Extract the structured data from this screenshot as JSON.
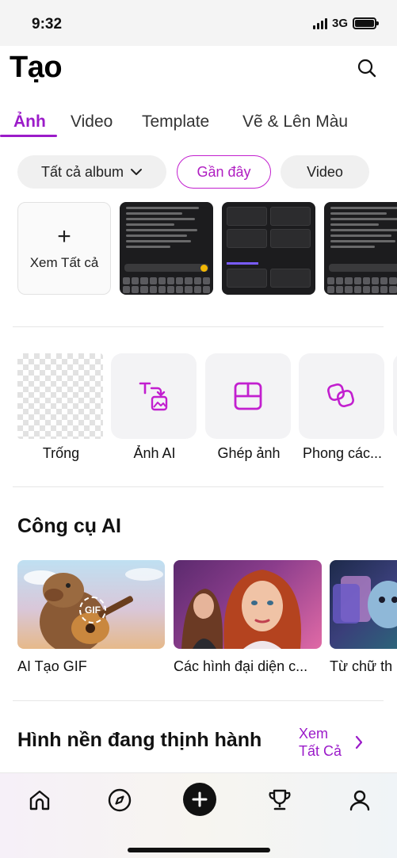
{
  "status_bar": {
    "time": "9:32",
    "network": "3G"
  },
  "header": {
    "title": "Tạo"
  },
  "tabs": [
    {
      "label": "Ảnh",
      "active": true
    },
    {
      "label": "Video",
      "active": false
    },
    {
      "label": "Template",
      "active": false
    },
    {
      "label": "Vẽ & Lên Màu",
      "active": false
    }
  ],
  "filters": {
    "album_label": "Tất cả album",
    "recent_label": "Gần đây",
    "video_label": "Video"
  },
  "recent": {
    "see_all_label": "Xem Tất cả"
  },
  "tools": [
    {
      "label": "Trống",
      "icon": "transparent-canvas-icon"
    },
    {
      "label": "Ảnh AI",
      "icon": "text-to-image-icon"
    },
    {
      "label": "Ghép ảnh",
      "icon": "collage-layout-icon"
    },
    {
      "label": "Phong các...",
      "icon": "style-shapes-icon"
    }
  ],
  "ai_tools": {
    "title": "Công cụ AI",
    "items": [
      {
        "label": "AI Tạo GIF",
        "badge": "GIF"
      },
      {
        "label": "Các hình đại diện c..."
      },
      {
        "label": "Từ chữ th"
      }
    ]
  },
  "trending": {
    "title": "Hình nền đang thịnh hành",
    "see_all_line1": "Xem",
    "see_all_line2": "Tất Cả"
  },
  "colors": {
    "accent": "#9b1bc9",
    "chip_active_border": "#c21fcf"
  }
}
